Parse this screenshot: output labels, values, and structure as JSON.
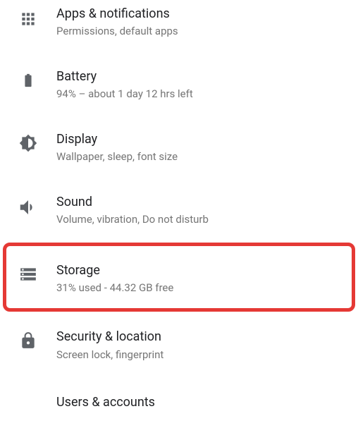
{
  "settings": {
    "items": [
      {
        "id": "apps",
        "title": "Apps & notifications",
        "subtitle": "Permissions, default apps"
      },
      {
        "id": "battery",
        "title": "Battery",
        "subtitle": "94% – about 1 day 12 hrs left"
      },
      {
        "id": "display",
        "title": "Display",
        "subtitle": "Wallpaper, sleep, font size"
      },
      {
        "id": "sound",
        "title": "Sound",
        "subtitle": "Volume, vibration, Do not disturb"
      },
      {
        "id": "storage",
        "title": "Storage",
        "subtitle": "31% used - 44.32 GB free",
        "highlighted": true
      },
      {
        "id": "security",
        "title": "Security & location",
        "subtitle": "Screen lock, fingerprint"
      },
      {
        "id": "users",
        "title": "Users & accounts",
        "subtitle": ""
      }
    ]
  }
}
